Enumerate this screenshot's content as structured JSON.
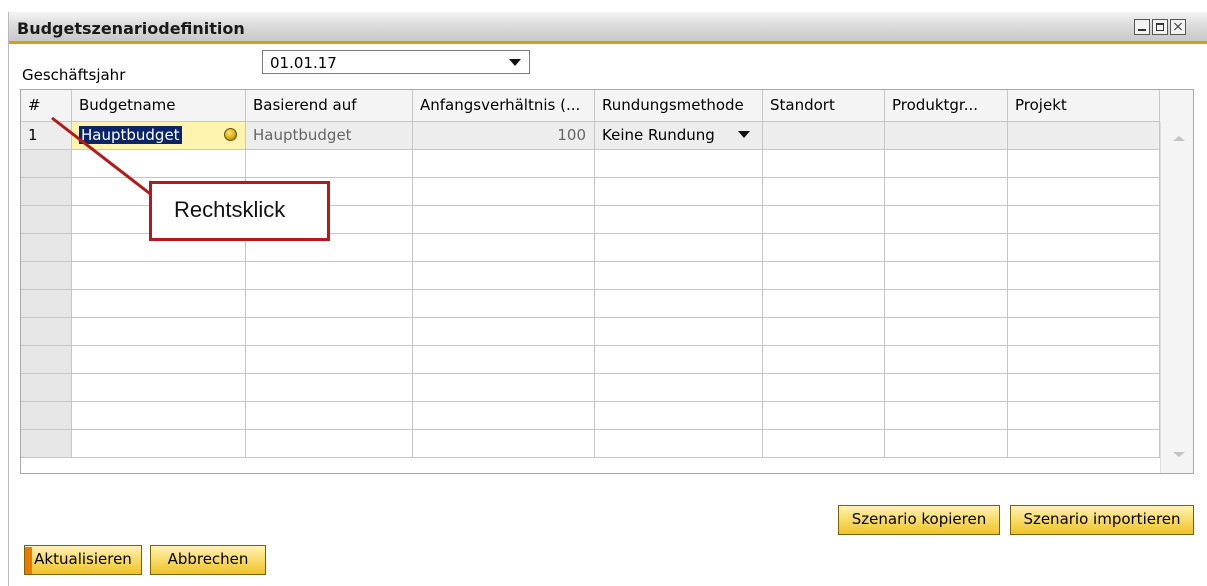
{
  "window": {
    "title": "Budgetszenariodefinition"
  },
  "fiscal_year": {
    "label": "Geschäftsjahr",
    "value": "01.01.17"
  },
  "table": {
    "columns": [
      "#",
      "Budgetname",
      "Basierend auf",
      "Anfangsverhältnis (...",
      "Rundungsmethode",
      "Standort",
      "Produktgr...",
      "Projekt"
    ],
    "rows": [
      {
        "num": "1",
        "budgetname": "Hauptbudget",
        "basierend_auf": "Hauptbudget",
        "anfangsverhaeltnis": "100",
        "rundungsmethode": "Keine Rundung",
        "standort": "",
        "produktgruppe": "",
        "projekt": ""
      }
    ],
    "empty_rows": 11
  },
  "buttons": {
    "copy": "Szenario kopieren",
    "import": "Szenario importieren",
    "update": "Aktualisieren",
    "cancel": "Abbrechen"
  },
  "annotation": {
    "text": "Rechtsklick",
    "color": "#b31b1b"
  },
  "colors": {
    "accent": "#d4a017",
    "button": "#f7d860",
    "selection": "#0a246a",
    "editing_cell": "#fff3b0"
  },
  "icons": [
    "minimize-icon",
    "maximize-icon",
    "close-icon",
    "lookup-icon",
    "dropdown-arrow-icon",
    "scroll-up-icon",
    "scroll-down-icon"
  ]
}
